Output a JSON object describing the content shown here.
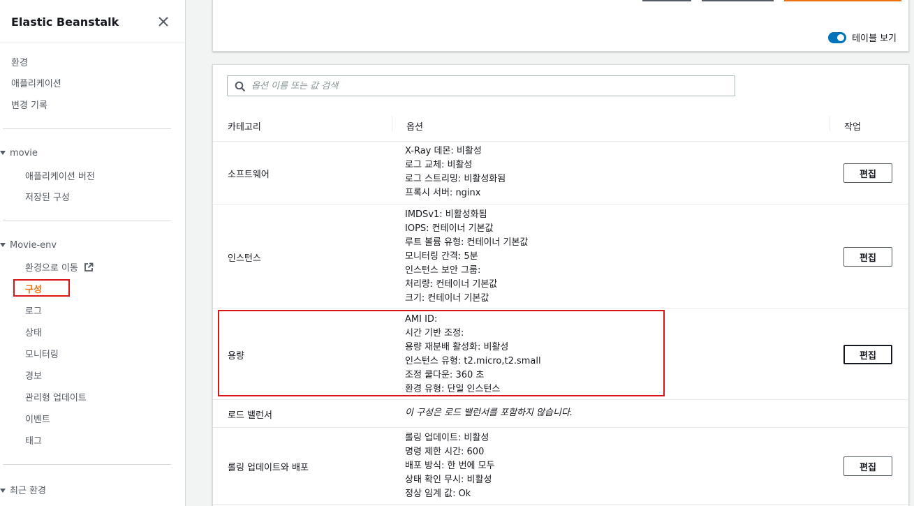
{
  "sidebar": {
    "title": "Elastic Beanstalk",
    "top_links": [
      "환경",
      "애플리케이션",
      "변경 기록"
    ],
    "app_group": {
      "name": "movie",
      "items": [
        "애플리케이션 버전",
        "저장된 구성"
      ]
    },
    "env_group": {
      "name": "Movie-env",
      "items": [
        "환경으로 이동",
        "구성",
        "로그",
        "상태",
        "모니터링",
        "경보",
        "관리형 업데이트",
        "이벤트",
        "태그"
      ],
      "active": "구성"
    },
    "recent": "최근 환경"
  },
  "top_panel": {
    "toggle_label": "테이블 보기",
    "toggle_on": true
  },
  "table": {
    "search_placeholder": "옵션 이름 또는 값 검색",
    "headers": {
      "category": "카테고리",
      "options": "옵션",
      "action": "작업"
    },
    "edit_label": "편집",
    "rows": [
      {
        "category": "소프트웨어",
        "options": [
          "X-Ray 데몬: 비활성",
          "로그 교체: 비활성",
          "로그 스트리밍: 비활성화됨",
          "프록시 서버: nginx"
        ]
      },
      {
        "category": "인스턴스",
        "options": [
          "IMDSv1: 비활성화됨",
          "IOPS: 컨테이너 기본값",
          "루트 볼륨 유형: 컨테이너 기본값",
          "모니터링 간격: 5분",
          "인스턴스 보안 그룹:",
          "처리량: 컨테이너 기본값",
          "크기: 컨테이너 기본값"
        ]
      },
      {
        "category": "용량",
        "options": [
          "AMI ID:",
          "시간 기반 조정:",
          "용량 재분배 활성화: 비활성",
          "인스턴스 유형: t2.micro,t2.small",
          "조정 쿨다운: 360 초",
          "환경 유형: 단일 인스턴스"
        ]
      },
      {
        "category": "로드 밸런서",
        "options": [
          "이 구성은 로드 밸런서를 포함하지 않습니다."
        ]
      },
      {
        "category": "롤링 업데이트와 배포",
        "options": [
          "롤링 업데이트: 비활성",
          "명령 제한 시간: 600",
          "배포 방식: 한 번에 모두",
          "상태 확인 무시: 비활성",
          "정상 임계 값: Ok"
        ]
      }
    ]
  },
  "colors": {
    "accent": "#ec7211",
    "link": "#0073bb",
    "highlight": "#d91515"
  },
  "icons": [
    "close-icon",
    "external-link-icon",
    "search-icon",
    "caret-down-icon"
  ]
}
